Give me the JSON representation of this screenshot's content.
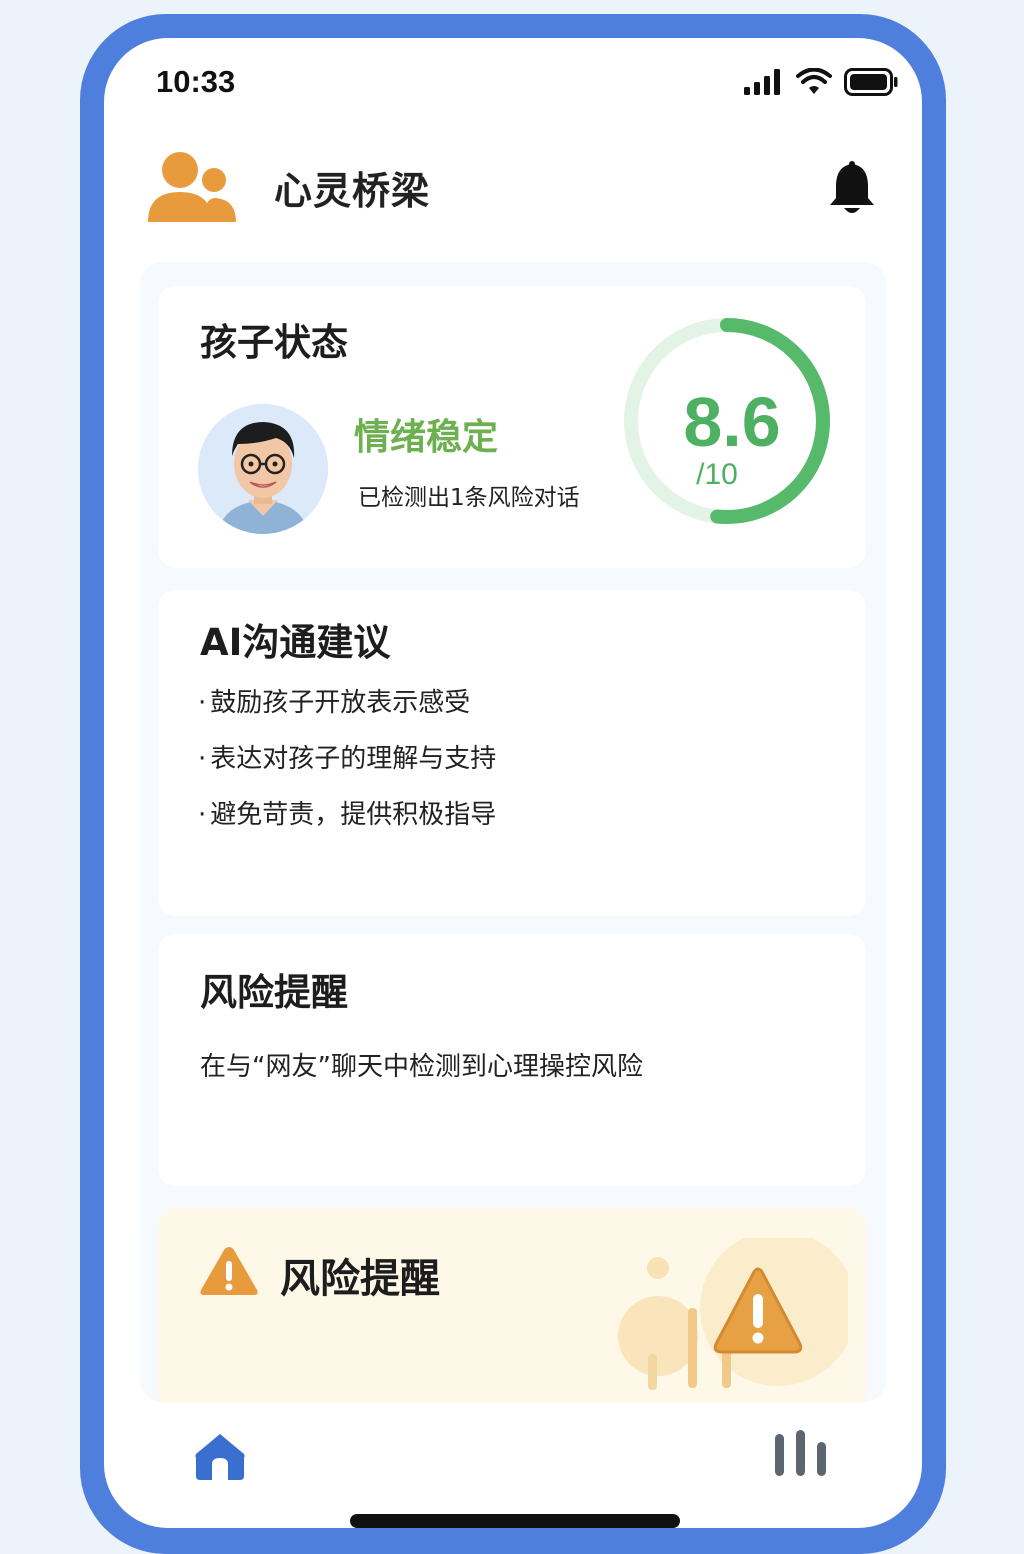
{
  "status_bar": {
    "time": "10:33"
  },
  "header": {
    "title": "心灵桥梁",
    "logo_icon": "users-icon",
    "bell_icon": "bell-icon"
  },
  "child_status": {
    "title": "孩子状态",
    "mood": "情绪稳定",
    "risk_count_text": "已检测出1条风险对话",
    "score": {
      "value": "8.6",
      "max": "/10",
      "fraction": 0.86
    }
  },
  "ai_advice": {
    "title": "AI沟通建议",
    "items": [
      {
        "bullet": "·",
        "text": "鼓励孩子开放表示感受"
      },
      {
        "bullet": "·",
        "text": "表达对孩子的理解与支持"
      },
      {
        "bullet": "·",
        "text": "避免苛责，提供积极指导"
      }
    ]
  },
  "risk_reminder": {
    "title": "风险提醒",
    "text": "在与“网友”聊天中检测到心理操控风险"
  },
  "warning_card": {
    "title": "风险提醒",
    "icon": "warning-icon"
  },
  "bottom_nav": {
    "home_icon": "home-icon",
    "stats_icon": "bar-chart-icon"
  },
  "colors": {
    "frame": "#4e7fdc",
    "accent_orange": "#e79b3c",
    "mood_green": "#6cb050",
    "score_green": "#4db063",
    "warning_bg": "#fdf8e8"
  }
}
